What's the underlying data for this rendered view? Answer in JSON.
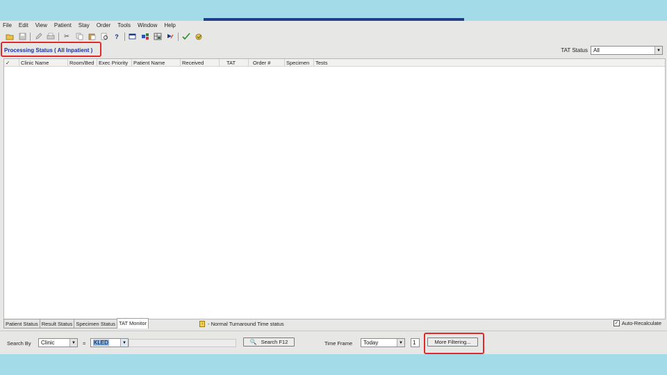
{
  "menu": [
    "File",
    "Edit",
    "View",
    "Patient",
    "Stay",
    "Order",
    "Tools",
    "Window",
    "Help"
  ],
  "toolbar": {
    "icons": [
      "open-icon",
      "save-icon",
      "edit-icon",
      "print-icon",
      "cut-icon",
      "copy-icon",
      "paste-icon",
      "print-preview-icon",
      "help-icon",
      "new-window-icon",
      "flowsheet-icon",
      "patient-grid-icon",
      "run-icon",
      "approve-icon",
      "refresh-icon"
    ]
  },
  "header": {
    "title": "Processing Status ( All Inpatient )",
    "tat_status_label": "TAT Status",
    "tat_status_value": "All"
  },
  "grid": {
    "columns": [
      "✓",
      "Clinic Name",
      "Room/Bed",
      "Exec Priority",
      "Patient Name",
      "Received",
      "TAT",
      "Order #",
      "Specimen",
      "Tests"
    ],
    "rows": []
  },
  "tabs": [
    {
      "label": "Patient Status",
      "active": false
    },
    {
      "label": "Result Status",
      "active": false
    },
    {
      "label": "Specimen Status",
      "active": false
    },
    {
      "label": "TAT Monitor",
      "active": true
    }
  ],
  "legend": {
    "text": "- Normal Turnaround Time status"
  },
  "autocalc": {
    "label": "Auto-Recalculate",
    "checked": true
  },
  "search": {
    "search_by_label": "Search By",
    "search_by_value": "Clinic",
    "operator": "=",
    "value": "KLED",
    "search_button": "Search F12",
    "time_frame_label": "Time Frame",
    "time_frame_value": "Today",
    "count_value": "1",
    "more_filtering_button": "More Filtering..."
  },
  "colors": {
    "highlight": "#e1282c",
    "title_blue": "#1a2fa8",
    "background": "#a4dbe9"
  }
}
